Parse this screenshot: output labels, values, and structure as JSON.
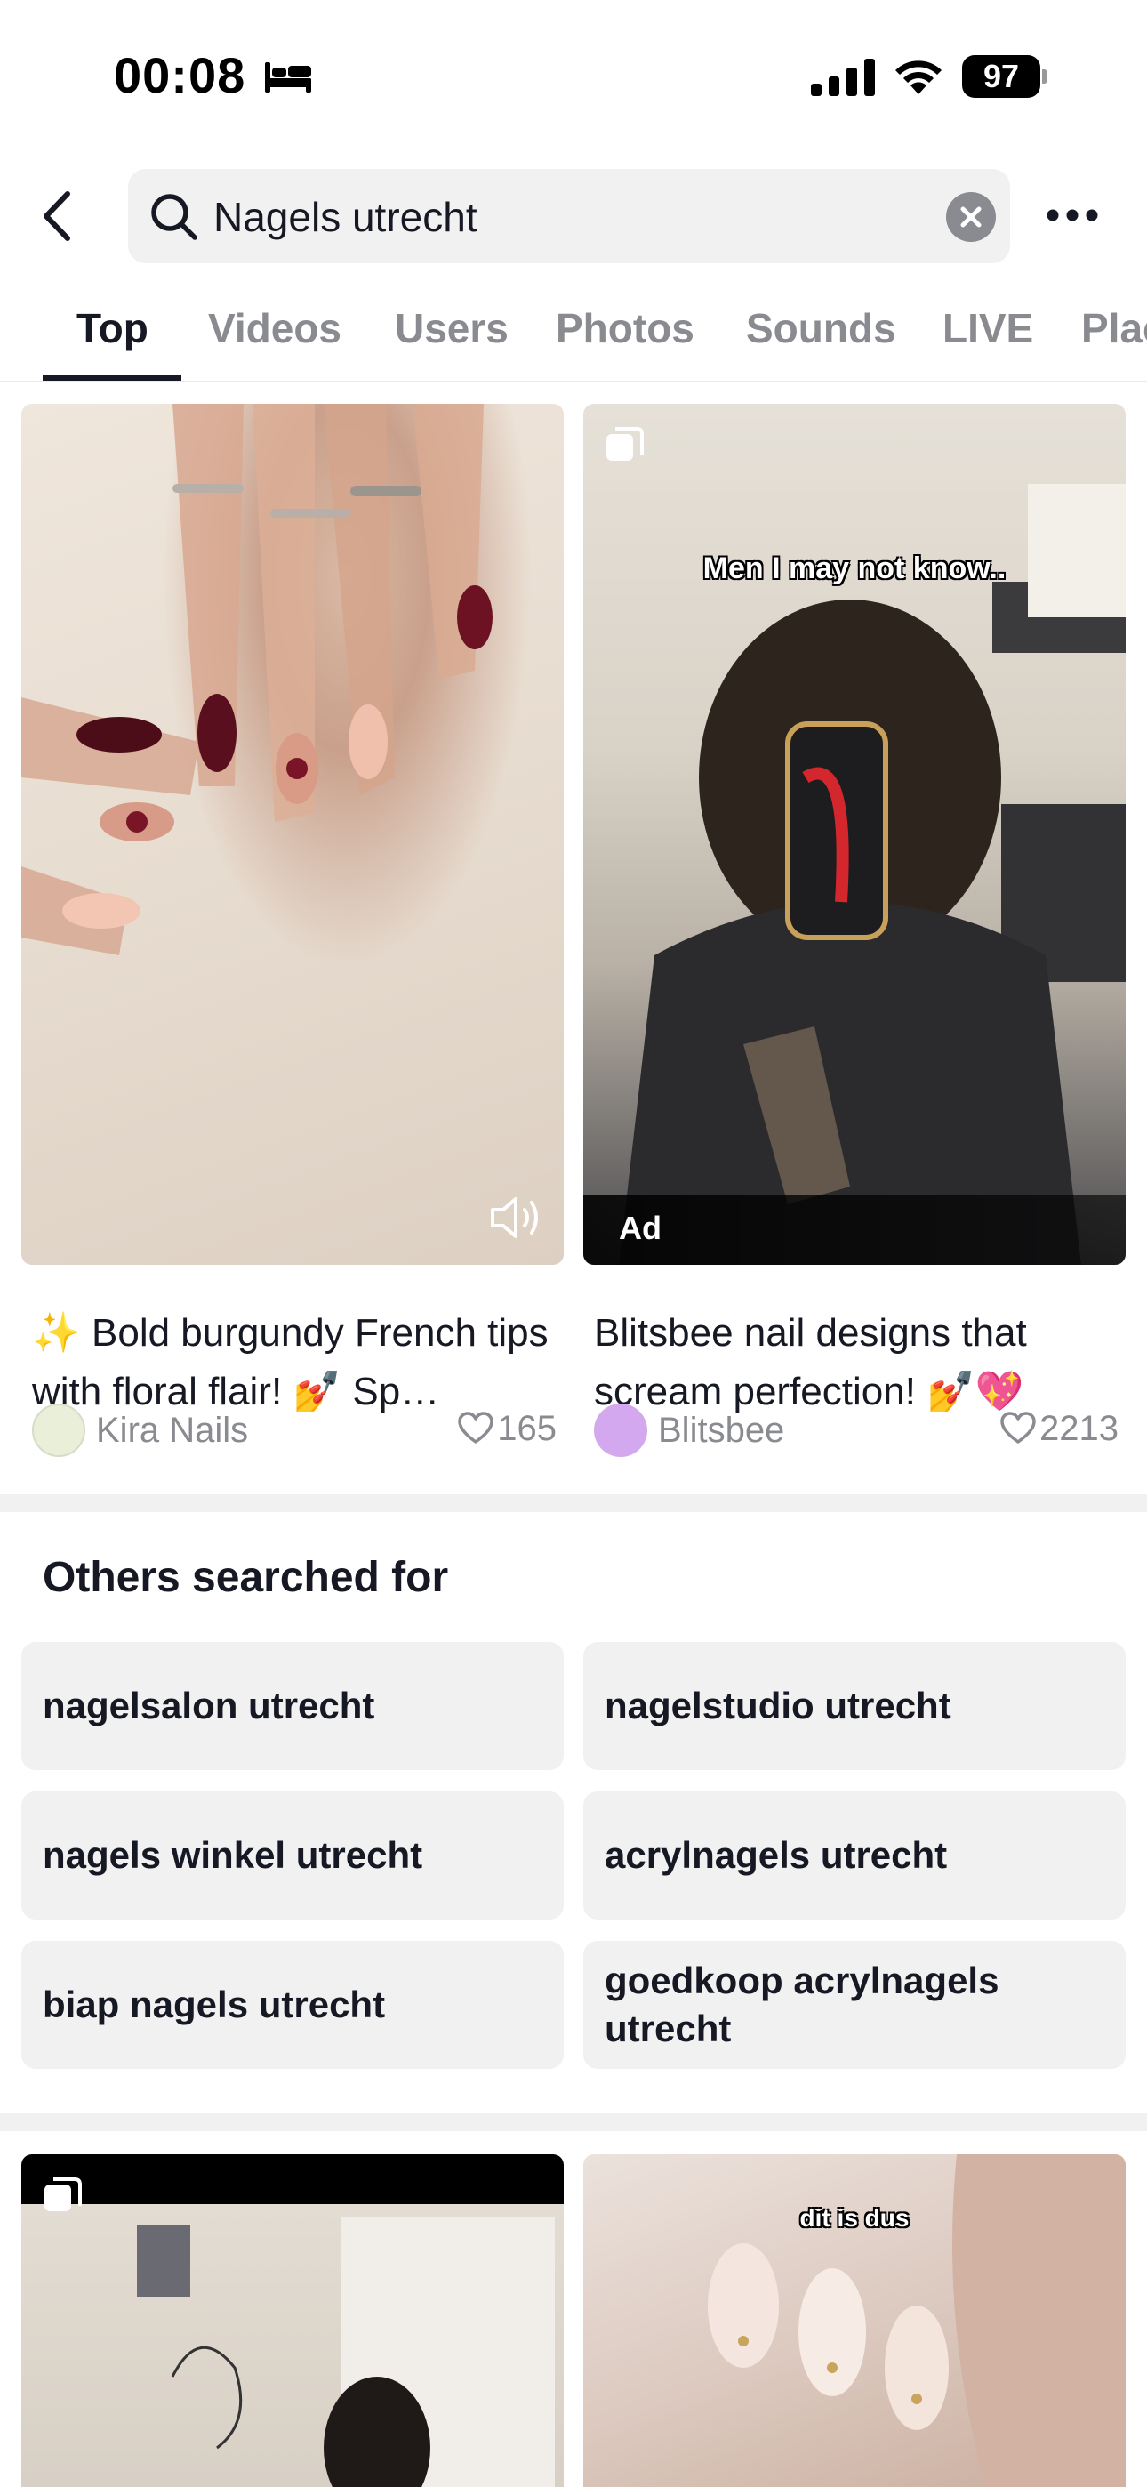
{
  "status_bar": {
    "time": "00:08",
    "battery": "97"
  },
  "search": {
    "query": "Nagels utrecht"
  },
  "tabs": [
    {
      "label": "Top",
      "active": true
    },
    {
      "label": "Videos",
      "active": false
    },
    {
      "label": "Users",
      "active": false
    },
    {
      "label": "Photos",
      "active": false
    },
    {
      "label": "Sounds",
      "active": false
    },
    {
      "label": "LIVE",
      "active": false
    },
    {
      "label": "Places",
      "active": false
    }
  ],
  "results": [
    {
      "caption": "✨ Bold burgundy French tips with floral flair! 💅 Sp…",
      "author": "Kira Nails",
      "likes": "165",
      "thumb_colors": [
        "#e9d8cc",
        "#cdb9ac"
      ]
    },
    {
      "caption": "Blitsbee nail designs that scream perfection! 💅💖",
      "author": "Blitsbee",
      "likes": "2213",
      "overlay_text": "Men I may not know..",
      "ad_label": "Ad",
      "thumb_colors": [
        "#d8d2c6",
        "#3a3a3c"
      ]
    }
  ],
  "others_searched": {
    "title": "Others searched for",
    "items": [
      "nagelsalon utrecht",
      "nagelstudio utrecht",
      "nagels winkel utrecht",
      "acrylnagels utrecht",
      "biap nagels utrecht",
      "goedkoop acrylnagels utrecht"
    ]
  },
  "more_results": [
    {
      "overlay_text": ""
    },
    {
      "overlay_text": "dit is dus"
    }
  ],
  "colors": {
    "text": "#161823",
    "muted": "#8a8b91",
    "chip_bg": "#f1f1f2"
  }
}
